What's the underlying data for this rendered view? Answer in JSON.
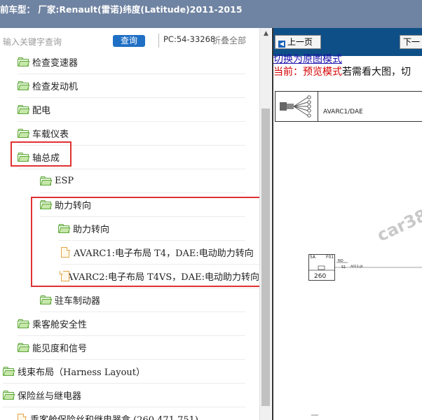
{
  "header": {
    "title": "前车型： 厂家:Renault(雷诺)纬度(Latitude)2011-2015"
  },
  "search": {
    "placeholder": "输入关键字查询",
    "button_label": "查询",
    "pc_code": "PC:54-33268",
    "collapse_all": "折叠全部"
  },
  "tree": {
    "items": [
      {
        "label": "检查变速器",
        "icon": "folder-icon"
      },
      {
        "label": "检查发动机",
        "icon": "folder-icon"
      },
      {
        "label": "配电",
        "icon": "folder-icon"
      },
      {
        "label": "车载仪表",
        "icon": "folder-icon"
      },
      {
        "label": "轴总成",
        "icon": "folder-icon"
      },
      {
        "label": "ESP",
        "icon": "folder-icon"
      },
      {
        "label": "助力转向",
        "icon": "folder-icon"
      },
      {
        "label": "助力转向",
        "icon": "folder-icon"
      },
      {
        "label": "AVARC1:电子布局 T4，DAE:电动助力转向",
        "icon": "file-icon"
      },
      {
        "label": "AVARC2:电子布局 T4VS，DAE:电动助力转向",
        "icon": "file-icon"
      },
      {
        "label": "驻车制动器",
        "icon": "folder-icon"
      },
      {
        "label": "乘客舱安全性",
        "icon": "folder-icon"
      },
      {
        "label": "能见度和信号",
        "icon": "folder-icon"
      },
      {
        "label": "线束布局（Harness Layout）",
        "icon": "folder-icon"
      },
      {
        "label": "保险丝与继电器",
        "icon": "folder-icon"
      },
      {
        "label": "乘客舱保险丝和继电器盒 (260,471,751)",
        "icon": "file-icon"
      }
    ]
  },
  "viewer": {
    "prev_label": "上一页",
    "next_label": "下一",
    "switch_link": "切换为原图模式",
    "preview_mode": "当前：预览模式",
    "preview_hint": "若需看大图，切",
    "diagram": {
      "header_label": "AVARC1/DAE",
      "watermark": "car38",
      "fuse_amp": "5A",
      "fuse_id": "F01",
      "fuse_number": "260",
      "wire_no": "NO",
      "wire_s1": "S1",
      "wire_code": "AP23-JA"
    }
  },
  "colors": {
    "topbar": "#6f83a2",
    "query_button": "#1f6fc5",
    "nav_bar": "#0f4f87",
    "highlight": "#e03131",
    "folder": "#5ea83a",
    "file": "#e3a54a"
  }
}
